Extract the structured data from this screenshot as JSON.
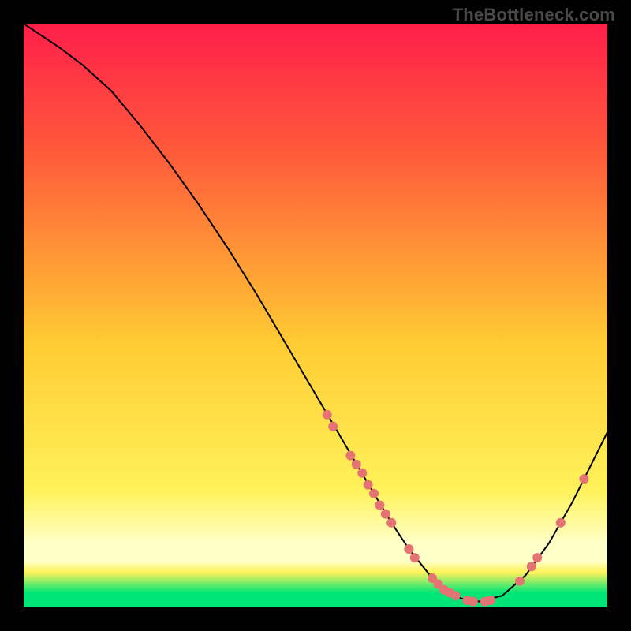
{
  "watermark": "TheBottleneck.com",
  "colors": {
    "bg": "#000000",
    "grad_top": "#ff1f4a",
    "grad_upper": "#ff5a3a",
    "grad_mid": "#ffcc33",
    "grad_lower": "#fff25a",
    "grad_band_pale": "#ffffc8",
    "grad_band_green": "#00e676",
    "curve": "#000000",
    "dot": "#e57373"
  },
  "chart_data": {
    "type": "line",
    "title": "",
    "xlabel": "",
    "ylabel": "",
    "xlim": [
      0,
      100
    ],
    "ylim": [
      0,
      100
    ],
    "grid": false,
    "legend": false,
    "annotations": [],
    "series": [
      {
        "name": "bottleneck-curve",
        "x": [
          0,
          3,
          6,
          10,
          15,
          20,
          25,
          30,
          35,
          40,
          45,
          50,
          55,
          60,
          63,
          66,
          70,
          73,
          75,
          78,
          82,
          86,
          90,
          94,
          97,
          100
        ],
        "y": [
          100,
          98,
          96,
          93,
          88.5,
          82.5,
          76,
          69,
          61.5,
          53.5,
          45,
          36.5,
          28,
          19.5,
          14.5,
          10,
          5,
          2.5,
          1.5,
          1,
          2,
          5.5,
          11,
          18,
          24,
          30
        ]
      }
    ],
    "markers": [
      {
        "x": 52,
        "y": 33
      },
      {
        "x": 53,
        "y": 31
      },
      {
        "x": 56,
        "y": 26
      },
      {
        "x": 57,
        "y": 24.5
      },
      {
        "x": 58,
        "y": 23
      },
      {
        "x": 59,
        "y": 21
      },
      {
        "x": 60,
        "y": 19.5
      },
      {
        "x": 61,
        "y": 17.5
      },
      {
        "x": 62,
        "y": 16
      },
      {
        "x": 63,
        "y": 14.5
      },
      {
        "x": 66,
        "y": 10
      },
      {
        "x": 67,
        "y": 8.5
      },
      {
        "x": 70,
        "y": 5
      },
      {
        "x": 71,
        "y": 4
      },
      {
        "x": 72,
        "y": 3
      },
      {
        "x": 73,
        "y": 2.5
      },
      {
        "x": 74,
        "y": 2
      },
      {
        "x": 76,
        "y": 1.2
      },
      {
        "x": 77,
        "y": 1
      },
      {
        "x": 79,
        "y": 1
      },
      {
        "x": 80,
        "y": 1.2
      },
      {
        "x": 85,
        "y": 4.5
      },
      {
        "x": 87,
        "y": 7
      },
      {
        "x": 88,
        "y": 8.5
      },
      {
        "x": 92,
        "y": 14.5
      },
      {
        "x": 96,
        "y": 22
      }
    ]
  }
}
